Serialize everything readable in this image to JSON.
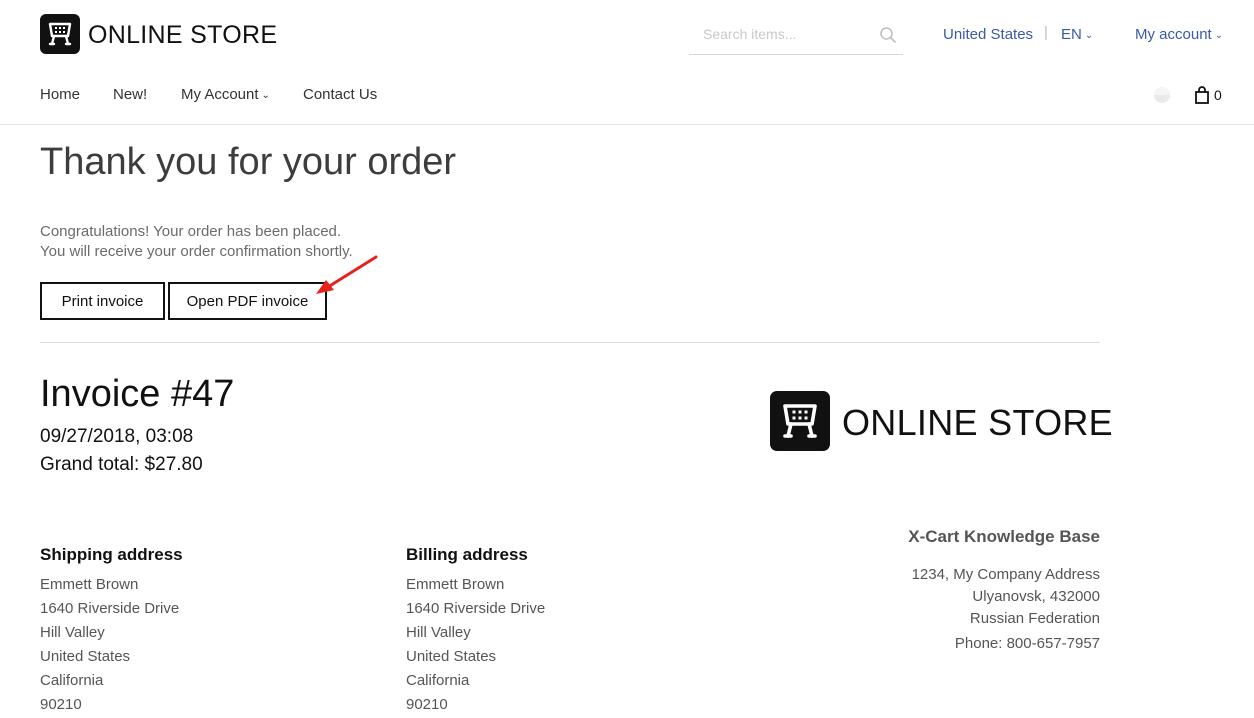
{
  "header": {
    "logo_text": "ONLINE STORE",
    "search_placeholder": "Search items...",
    "country": "United States",
    "separator": "|",
    "language": "EN",
    "account": "My account"
  },
  "nav": {
    "items": [
      "Home",
      "New!",
      "My Account",
      "Contact Us"
    ],
    "cart_count": "0"
  },
  "main": {
    "title": "Thank you for your order",
    "message_line1": "Congratulations! Your order has been placed.",
    "message_line2": "You will receive your order confirmation shortly.",
    "print_invoice_label": "Print invoice",
    "open_pdf_label": "Open PDF invoice"
  },
  "invoice": {
    "title": "Invoice #47",
    "date": "09/27/2018, 03:08",
    "grand_total": "Grand total: $27.80",
    "logo_text": "ONLINE STORE",
    "shipping": {
      "heading": "Shipping address",
      "lines": [
        "Emmett  Brown",
        "1640 Riverside Drive",
        "Hill Valley",
        "United States",
        "California",
        "90210"
      ]
    },
    "billing": {
      "heading": "Billing address",
      "lines": [
        "Emmett  Brown",
        "1640 Riverside Drive",
        "Hill Valley",
        "United States",
        "California",
        "90210"
      ]
    },
    "company": {
      "name": "X-Cart Knowledge Base",
      "address1": "1234, My Company Address",
      "address2": "Ulyanovsk, 432000",
      "country": "Russian Federation",
      "phone": "Phone: 800-657-7957"
    }
  },
  "colors": {
    "link": "#3b5aa6",
    "arrow": "#e8221b",
    "text_dark": "#111111"
  },
  "icons": [
    "store-logo-icon",
    "search-icon",
    "chevron-down-icon",
    "spinner-icon",
    "shopping-bag-icon",
    "red-arrow-annotation"
  ]
}
